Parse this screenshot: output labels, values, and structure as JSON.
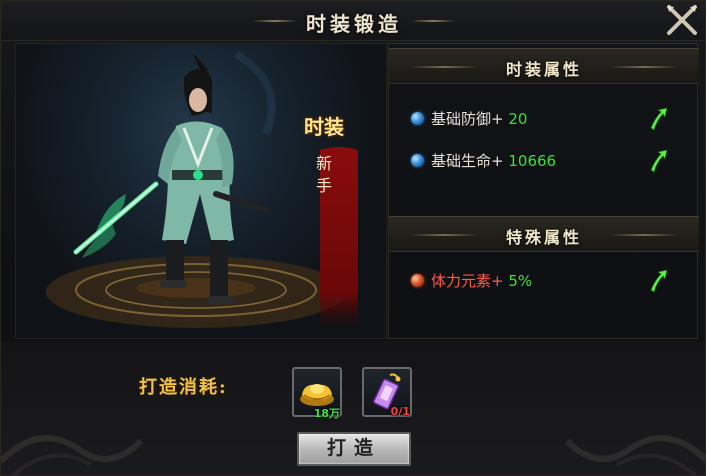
{
  "window": {
    "title": "时装锻造"
  },
  "character": {
    "banner_title": "时装",
    "banner_sub": "新手"
  },
  "fashion_attrs": {
    "header": "时装属性",
    "items": [
      {
        "name": "基础防御+",
        "value": "20",
        "orb": "blue"
      },
      {
        "name": "基础生命+",
        "value": "10666",
        "orb": "blue"
      }
    ]
  },
  "special_attrs": {
    "header": "特殊属性",
    "items": [
      {
        "name": "体力元素+",
        "value": "5%",
        "orb": "red"
      }
    ]
  },
  "cost": {
    "label": "打造消耗:",
    "items": [
      {
        "icon": "gold-ingot-icon",
        "count": "18万"
      },
      {
        "icon": "fashion-scroll-icon",
        "count": "0/1"
      }
    ]
  },
  "forge_button": "打造",
  "colors": {
    "value_green": "#38e23a",
    "special_red": "#ff5a4a",
    "cost_gold": "#f0c24a",
    "insufficient_red": "#ff4040"
  }
}
